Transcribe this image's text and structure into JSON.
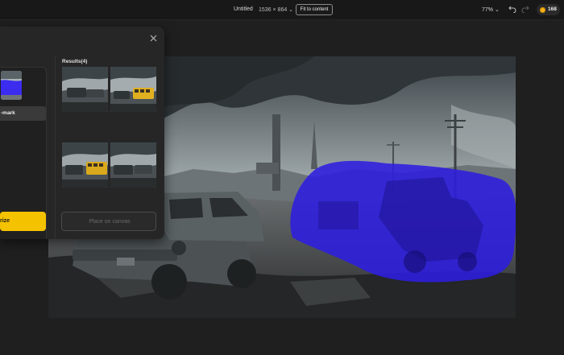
{
  "topbar": {
    "doc_title": "Untitled",
    "doc_size": "1536 × 864 ⌄",
    "fit_button": "Fit to content",
    "zoom": "77% ⌄",
    "credits": "168"
  },
  "panel": {
    "partial_label": "-mark",
    "vectorize_label": "rize",
    "results_title": "Results(4)",
    "place_button": "Place on canvas",
    "results": [
      {
        "variant": "plain"
      },
      {
        "variant": "school-bus"
      },
      {
        "variant": "school-bus"
      },
      {
        "variant": "plain"
      }
    ]
  },
  "canvas": {
    "image_subject": "post-apocalyptic wasteland with wrecked car and mask overlay",
    "mask_color": "#2d1ee0"
  },
  "colors": {
    "accent_yellow": "#f5c200",
    "background": "#1f1f1f",
    "panel": "#262626"
  }
}
